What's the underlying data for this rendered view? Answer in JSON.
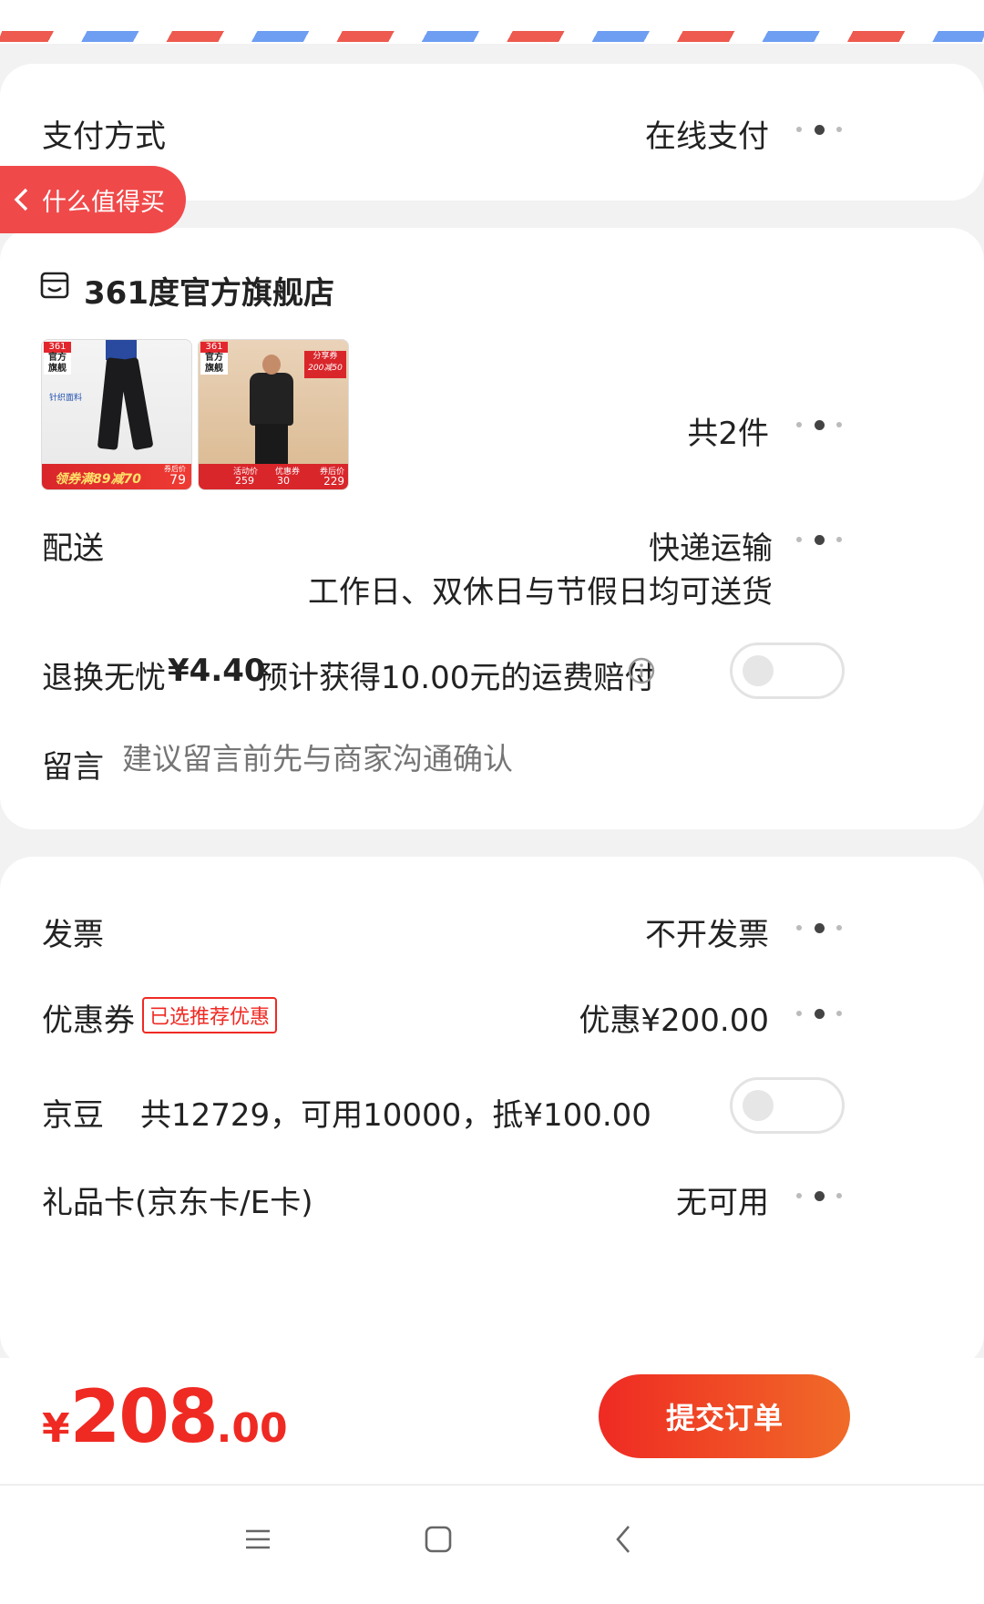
{
  "header": {
    "airmail_colors": [
      "#ee5a4f",
      "#6e9ef2"
    ]
  },
  "payment": {
    "label": "支付方式",
    "value": "在线支付"
  },
  "floating_back": {
    "label": "什么值得买"
  },
  "store": {
    "name": "361度官方旗舰店",
    "products": [
      {
        "badge_top": "361",
        "badge_line1": "官方",
        "badge_line2": "旗舰",
        "feature_text": "针织面料",
        "promo_text": "领券满89减70",
        "price_label": "券后价",
        "price": "79"
      },
      {
        "badge_top": "361",
        "badge_line1": "官方",
        "badge_line2": "旗舰",
        "coupon_title": "分享券",
        "coupon_text": "200减50",
        "bottom_price_a": "259",
        "bottom_price_b": "30",
        "bottom_price_c": "229",
        "bottom_label_a": "活动价",
        "bottom_label_b": "优惠券",
        "bottom_label_c": "券后价"
      }
    ],
    "count_text": "共2件"
  },
  "delivery": {
    "label": "配送",
    "method": "快递运输",
    "note": "工作日、双休日与节假日均可送货"
  },
  "return_insurance": {
    "label": "退换无忧",
    "price": "¥4.40",
    "desc": "预计获得10.00元的运费赔付",
    "info_icon": "info-icon",
    "enabled": false
  },
  "message": {
    "label": "留言",
    "placeholder": "建议留言前先与商家沟通确认"
  },
  "invoice": {
    "label": "发票",
    "value": "不开发票"
  },
  "coupon": {
    "label": "优惠券",
    "tag": "已选推荐优惠",
    "value": "优惠¥200.00"
  },
  "jingdou": {
    "label": "京豆",
    "desc": "共12729，可用10000，抵¥100.00",
    "enabled": false
  },
  "giftcard": {
    "label": "礼品卡(京东卡/E卡)",
    "value": "无可用"
  },
  "footer": {
    "currency": "¥",
    "amount_int": "208",
    "amount_dec": ".00",
    "submit_label": "提交订单",
    "accent_color": "#ef2a23"
  },
  "navbar": {
    "icons": [
      "menu-icon",
      "home-icon",
      "back-icon"
    ]
  }
}
